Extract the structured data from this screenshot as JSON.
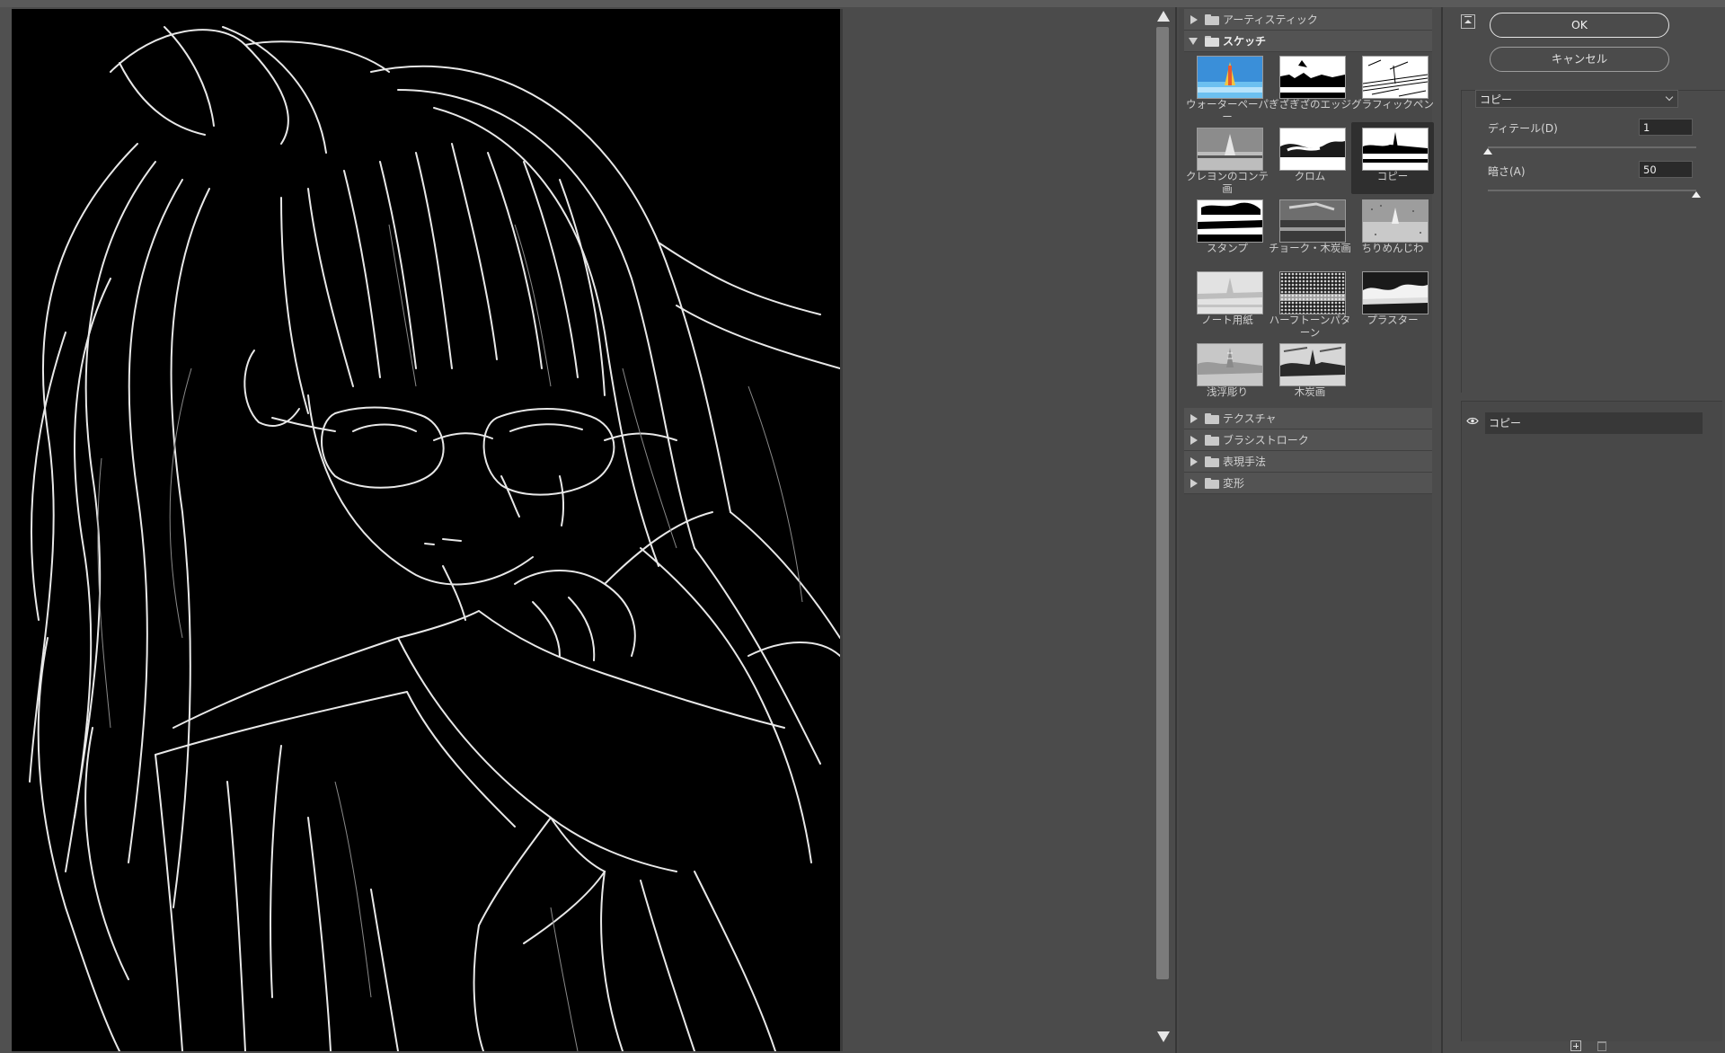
{
  "filter_gallery": {
    "categories": [
      {
        "label": "アーティスティック",
        "expanded": false
      },
      {
        "label": "スケッチ",
        "expanded": true
      },
      {
        "label": "テクスチャ",
        "expanded": false
      },
      {
        "label": "ブラシストローク",
        "expanded": false
      },
      {
        "label": "表現手法",
        "expanded": false
      },
      {
        "label": "変形",
        "expanded": false
      }
    ],
    "sketch_filters": [
      {
        "label": "ウォーターペーパー",
        "selected": false
      },
      {
        "label": "ぎざぎざのエッジ",
        "selected": false
      },
      {
        "label": "グラフィックペン",
        "selected": false
      },
      {
        "label": "クレヨンのコンテ画",
        "selected": false
      },
      {
        "label": "クロム",
        "selected": false
      },
      {
        "label": "コピー",
        "selected": true
      },
      {
        "label": "スタンプ",
        "selected": false
      },
      {
        "label": "チョーク・木炭画",
        "selected": false
      },
      {
        "label": "ちりめんじわ",
        "selected": false
      },
      {
        "label": "ノート用紙",
        "selected": false
      },
      {
        "label": "ハーフトーンパターン",
        "selected": false
      },
      {
        "label": "プラスター",
        "selected": false
      },
      {
        "label": "浅浮彫り",
        "selected": false
      },
      {
        "label": "木炭画",
        "selected": false
      }
    ]
  },
  "buttons": {
    "ok": "OK",
    "cancel": "キャンセル"
  },
  "settings": {
    "filter_select": "コピー",
    "detail": {
      "label": "ディテール(D)",
      "value": "1",
      "fraction": 0.0
    },
    "darkness": {
      "label": "暗さ(A)",
      "value": "50",
      "fraction": 1.0
    }
  },
  "layers": [
    {
      "name": "コピー",
      "visible": true
    }
  ],
  "icons": {
    "collapse": "collapse-panel-icon",
    "eye": "eye-icon",
    "folder": "folder-icon",
    "new_layer": "new-effect-layer-icon",
    "delete_layer": "delete-effect-layer-icon"
  }
}
